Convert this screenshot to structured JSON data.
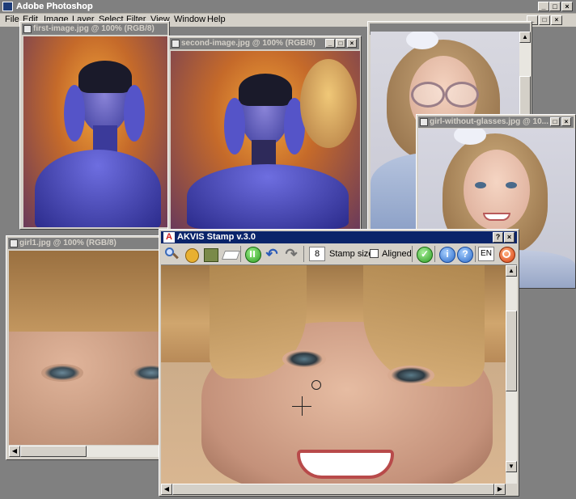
{
  "app": {
    "title": "Adobe Photoshop",
    "menu": [
      "File",
      "Edit",
      "Image",
      "Layer",
      "Select",
      "Filter",
      "View",
      "Window",
      "Help"
    ],
    "controls": {
      "minimize": "_",
      "maximize": "□",
      "close": "×"
    }
  },
  "windows": {
    "first": {
      "title": "first-image.jpg @ 100% (RGB/8)"
    },
    "second": {
      "title": "second-image.jpg @ 100% (RGB/8)"
    },
    "glasses": {
      "title": ""
    },
    "noglasses": {
      "title": "girl-without-glasses.jpg @ 10..."
    },
    "girl1": {
      "title": "girl1.jpg @ 100% (RGB/8)"
    }
  },
  "akvis": {
    "title": "AKVIS Stamp v.3.0",
    "help_label": "?",
    "close_label": "×",
    "stamp_size_value": "8",
    "stamp_size_label": "Stamp size",
    "aligned_label": "Aligned",
    "language": "EN",
    "tools": [
      "zoom-icon",
      "hand-icon",
      "stamp-icon",
      "eraser-icon",
      "play-icon",
      "undo-icon",
      "redo-icon",
      "apply-icon",
      "info-icon",
      "help-icon",
      "exit-icon"
    ]
  },
  "colors": {
    "title_active": "#0a246a",
    "title_inactive": "#808080",
    "chrome": "#d4d0c8",
    "workspace": "#808080"
  }
}
